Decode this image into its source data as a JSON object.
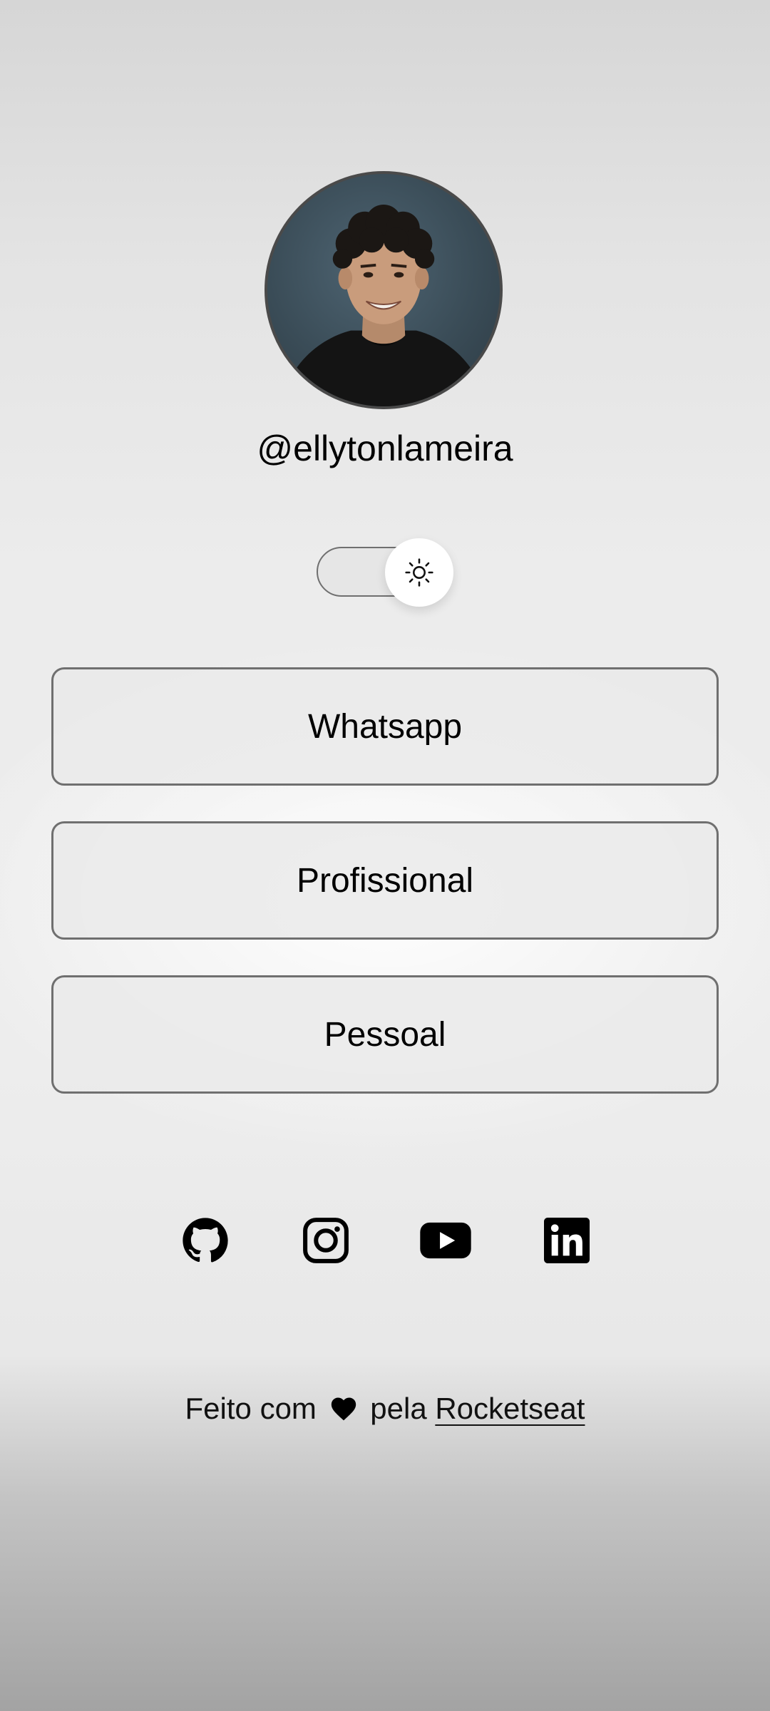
{
  "profile": {
    "handle": "@ellytonlameira",
    "avatar_icon": "profile-photo"
  },
  "theme_toggle": {
    "icon": "sun-icon",
    "state": "light"
  },
  "links": [
    {
      "label": "Whatsapp"
    },
    {
      "label": "Profissional"
    },
    {
      "label": "Pessoal"
    }
  ],
  "social": [
    {
      "icon": "github-icon"
    },
    {
      "icon": "instagram-icon"
    },
    {
      "icon": "youtube-icon"
    },
    {
      "icon": "linkedin-icon"
    }
  ],
  "footer": {
    "prefix": "Feito com",
    "middle": "pela",
    "link": "Rocketseat"
  }
}
